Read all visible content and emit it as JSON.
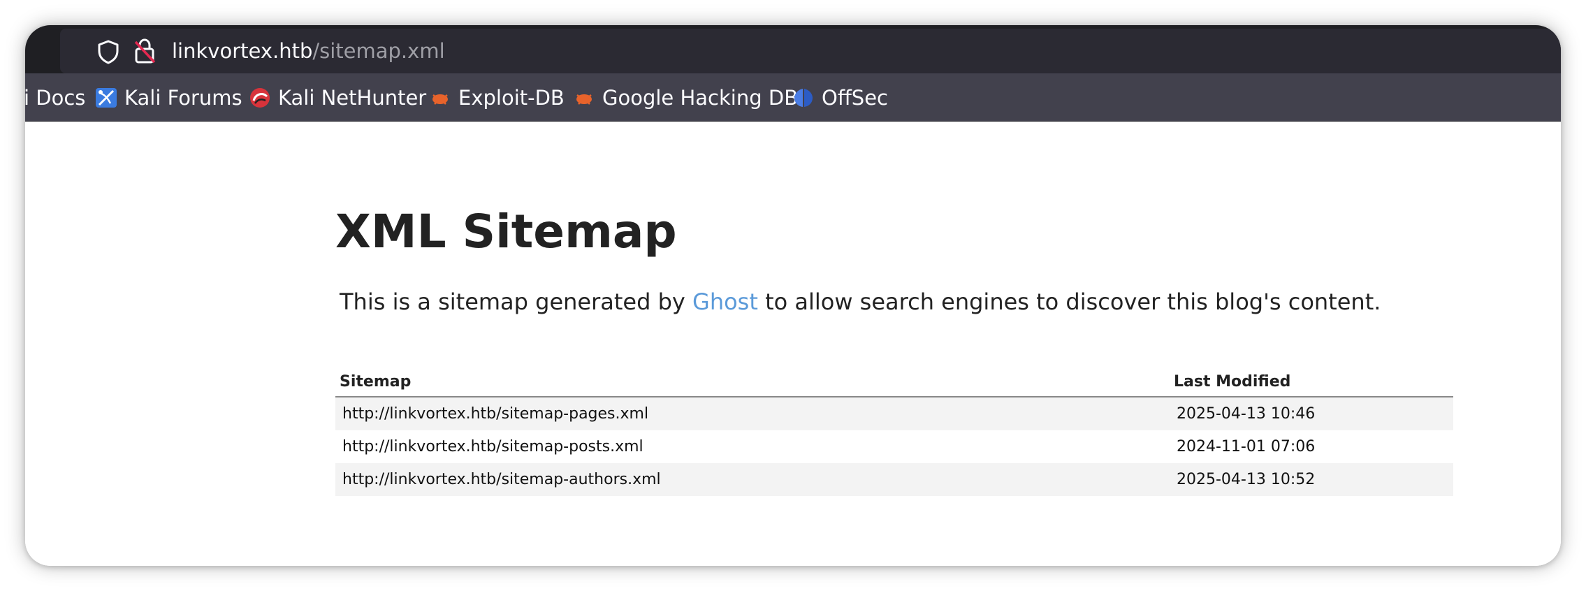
{
  "browser": {
    "url_host": "linkvortex.htb",
    "url_path": "/sitemap.xml",
    "bookmarks": [
      {
        "label": "i Docs",
        "icon": "kali-docs-icon"
      },
      {
        "label": "Kali Forums",
        "icon": "kali-forums-icon"
      },
      {
        "label": "Kali NetHunter",
        "icon": "kali-nethunter-icon"
      },
      {
        "label": "Exploit-DB",
        "icon": "exploit-db-icon"
      },
      {
        "label": "Google Hacking DB",
        "icon": "google-hacking-db-icon"
      },
      {
        "label": "OffSec",
        "icon": "offsec-icon"
      }
    ]
  },
  "page": {
    "title": "XML Sitemap",
    "intro_before": "This is a sitemap generated by ",
    "intro_link": "Ghost",
    "intro_after": " to allow search engines to discover this blog's content.",
    "table": {
      "headers": [
        "Sitemap",
        "Last Modified"
      ],
      "rows": [
        {
          "url": "http://linkvortex.htb/sitemap-pages.xml",
          "modified": "2025-04-13 10:46"
        },
        {
          "url": "http://linkvortex.htb/sitemap-posts.xml",
          "modified": "2024-11-01 07:06"
        },
        {
          "url": "http://linkvortex.htb/sitemap-authors.xml",
          "modified": "2025-04-13 10:52"
        }
      ]
    }
  },
  "colors": {
    "link": "#5b9ad9",
    "toolbar": "#42414d",
    "urlbar": "#2b2a33",
    "row_stripe": "#f3f3f3"
  }
}
